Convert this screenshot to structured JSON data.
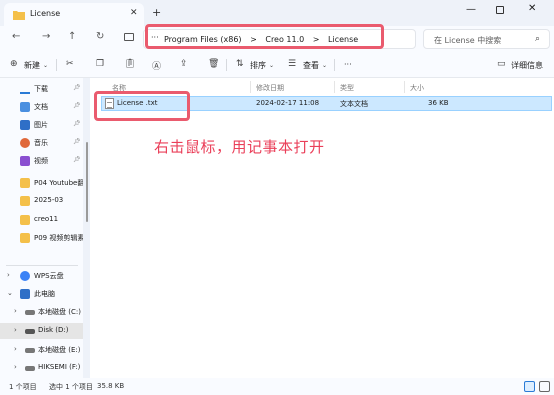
{
  "window": {
    "tab_title": "License",
    "new_tab": "+",
    "close_tab": "✕"
  },
  "nav": {
    "back": "←",
    "forward": "→",
    "up": "↑",
    "refresh": "↻",
    "more": "···",
    "breadcrumb": [
      "Program Files (x86)",
      "Creo 11.0",
      "License"
    ],
    "separator": ">",
    "search_placeholder": "在 License 中搜索"
  },
  "toolbar": {
    "new_label": "新建",
    "sort_label": "排序",
    "view_label": "查看",
    "more": "···",
    "details_label": "详细信息"
  },
  "sidebar": {
    "items": [
      {
        "label": "下载",
        "icon": "download-icon",
        "pinned": true
      },
      {
        "label": "文档",
        "icon": "document-icon",
        "pinned": true
      },
      {
        "label": "图片",
        "icon": "picture-icon",
        "pinned": true
      },
      {
        "label": "音乐",
        "icon": "music-icon",
        "pinned": true
      },
      {
        "label": "视频",
        "icon": "video-icon",
        "pinned": true
      },
      {
        "label": "P04 Youtube翻",
        "icon": "folder-icon",
        "pinned": false
      },
      {
        "label": "2025-03",
        "icon": "folder-icon",
        "pinned": false
      },
      {
        "label": "creo11",
        "icon": "folder-icon",
        "pinned": false
      },
      {
        "label": "P09 视频剪辑素",
        "icon": "folder-icon",
        "pinned": false
      },
      {
        "label": "WPS云盘",
        "icon": "cloud-icon",
        "pinned": false
      },
      {
        "label": "此电脑",
        "icon": "computer-icon",
        "pinned": false
      },
      {
        "label": "本地磁盘 (C:)",
        "icon": "drive-icon",
        "pinned": false
      },
      {
        "label": "Disk (D:)",
        "icon": "drive-icon",
        "pinned": false
      },
      {
        "label": "本地磁盘 (E:)",
        "icon": "drive-icon",
        "pinned": false
      },
      {
        "label": "HIKSEMI (F:)",
        "icon": "drive-icon",
        "pinned": false
      }
    ]
  },
  "columns": {
    "name": "名称",
    "modified": "修改日期",
    "type": "类型",
    "size": "大小"
  },
  "files": [
    {
      "name": "License .txt",
      "modified": "2024-02-17 11:08",
      "type": "文本文档",
      "size": "36 KB"
    }
  ],
  "annotation": {
    "text": "右击鼠标，用记事本打开"
  },
  "status": {
    "count": "1 个项目",
    "selected": "选中 1 个项目",
    "size": "35.8 KB"
  },
  "colors": {
    "accent": "#ea5b6e",
    "selection": "#cce8ff"
  }
}
